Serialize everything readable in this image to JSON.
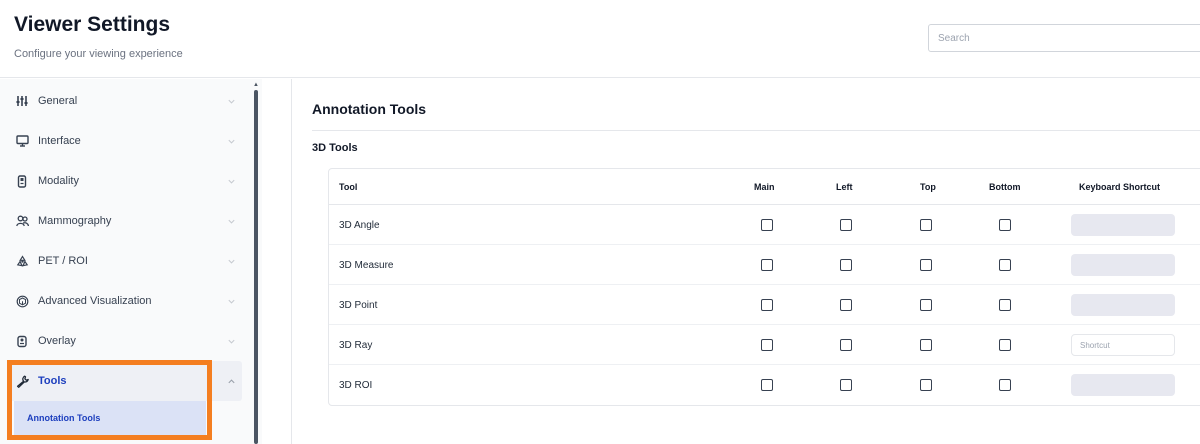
{
  "header": {
    "title": "Viewer Settings",
    "subtitle": "Configure your viewing experience",
    "search_placeholder": "Search"
  },
  "sidebar": {
    "items": [
      {
        "label": "General",
        "icon": "sliders-icon"
      },
      {
        "label": "Interface",
        "icon": "monitor-icon"
      },
      {
        "label": "Modality",
        "icon": "device-icon"
      },
      {
        "label": "Mammography",
        "icon": "users-icon"
      },
      {
        "label": "PET / ROI",
        "icon": "radiation-icon"
      },
      {
        "label": "Advanced Visualization",
        "icon": "cube-icon"
      },
      {
        "label": "Overlay",
        "icon": "layers-icon"
      },
      {
        "label": "Tools",
        "icon": "wrench-icon"
      }
    ],
    "active_item": "Tools",
    "sub_item": "Annotation Tools"
  },
  "main": {
    "section_title": "Annotation Tools",
    "group_title": "3D Tools",
    "table": {
      "columns": [
        "Tool",
        "Main",
        "Left",
        "Top",
        "Bottom",
        "Keyboard Shortcut"
      ],
      "rows": [
        {
          "tool": "3D Angle",
          "main": false,
          "left": false,
          "top": false,
          "bottom": false,
          "shortcut_state": "filled"
        },
        {
          "tool": "3D Measure",
          "main": false,
          "left": false,
          "top": false,
          "bottom": false,
          "shortcut_state": "filled"
        },
        {
          "tool": "3D Point",
          "main": false,
          "left": false,
          "top": false,
          "bottom": false,
          "shortcut_state": "filled"
        },
        {
          "tool": "3D Ray",
          "main": false,
          "left": false,
          "top": false,
          "bottom": false,
          "shortcut_state": "input",
          "shortcut_placeholder": "Shortcut"
        },
        {
          "tool": "3D ROI",
          "main": false,
          "left": false,
          "top": false,
          "bottom": false,
          "shortcut_state": "filled"
        }
      ]
    }
  },
  "colors": {
    "accent": "#1d3fbe",
    "highlight": "#f47e20",
    "sub_item_bg": "#dbe2f6",
    "shortcut_bg": "#e7e8f0"
  }
}
